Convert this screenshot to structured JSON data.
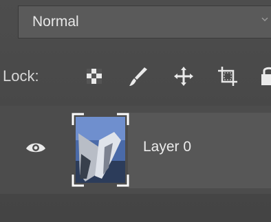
{
  "blend_mode": {
    "selected": "Normal"
  },
  "lock": {
    "label": "Lock:",
    "icons": [
      "lock-transparent-pixels-icon",
      "lock-image-pixels-icon",
      "lock-position-icon",
      "lock-artboard-icon",
      "lock-all-icon"
    ]
  },
  "layers": [
    {
      "name": "Layer 0",
      "visible": true,
      "selected": true
    }
  ],
  "colors": {
    "panel": "#4a4a4a",
    "text": "#e8e8e8",
    "selection": "#ffffff"
  }
}
